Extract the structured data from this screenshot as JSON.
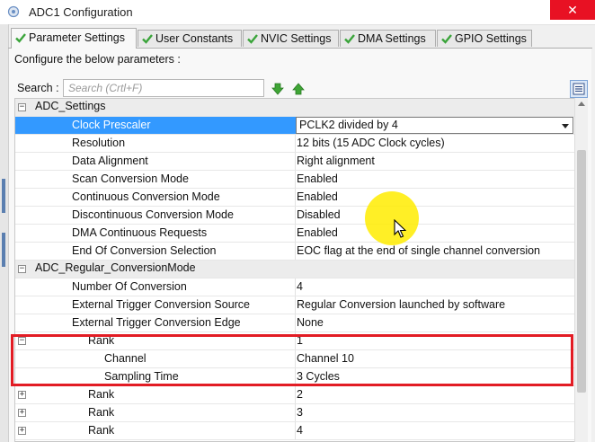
{
  "window": {
    "title": "ADC1 Configuration",
    "close_glyph": "✕"
  },
  "tabs": [
    {
      "label": "Parameter Settings",
      "active": true
    },
    {
      "label": "User Constants",
      "active": false
    },
    {
      "label": "NVIC Settings",
      "active": false
    },
    {
      "label": "DMA Settings",
      "active": false
    },
    {
      "label": "GPIO Settings",
      "active": false
    }
  ],
  "intro": "Configure the below parameters :",
  "search": {
    "label": "Search :",
    "placeholder": "Search (Crtl+F)"
  },
  "groups": {
    "adc_settings": "ADC_Settings",
    "regular_conversion": "ADC_Regular_ConversionMode"
  },
  "params": [
    {
      "name": "Clock Prescaler",
      "value": "PCLK2 divided by 4"
    },
    {
      "name": "Resolution",
      "value": "12 bits (15 ADC Clock cycles)"
    },
    {
      "name": "Data Alignment",
      "value": "Right alignment"
    },
    {
      "name": "Scan Conversion Mode",
      "value": "Enabled"
    },
    {
      "name": "Continuous Conversion Mode",
      "value": "Enabled"
    },
    {
      "name": "Discontinuous Conversion Mode",
      "value": "Disabled"
    },
    {
      "name": "DMA Continuous Requests",
      "value": "Enabled"
    },
    {
      "name": "End Of Conversion Selection",
      "value": "EOC flag at the end of single channel conversion"
    },
    {
      "name": "Number Of Conversion",
      "value": "4"
    },
    {
      "name": "External Trigger Conversion Source",
      "value": "Regular Conversion launched by software"
    },
    {
      "name": "External Trigger Conversion Edge",
      "value": "None"
    }
  ],
  "ranks": [
    {
      "name": "Rank",
      "value": "1",
      "expanded": true,
      "children": [
        {
          "name": "Channel",
          "value": "Channel 10"
        },
        {
          "name": "Sampling Time",
          "value": "3 Cycles"
        }
      ]
    },
    {
      "name": "Rank",
      "value": "2",
      "expanded": false
    },
    {
      "name": "Rank",
      "value": "3",
      "expanded": false
    },
    {
      "name": "Rank",
      "value": "4",
      "expanded": false
    }
  ],
  "toggle_glyphs": {
    "expanded": "−",
    "collapsed": "+"
  },
  "colors": {
    "selection": "#3399ff",
    "highlight_box": "#e21c24",
    "cursor_highlight": "#ffec00",
    "close": "#e81123"
  },
  "icons": {
    "tab_check": "green-check-icon",
    "down": "green-down-arrow-icon",
    "up": "green-up-arrow-icon",
    "view": "list-view-icon"
  }
}
